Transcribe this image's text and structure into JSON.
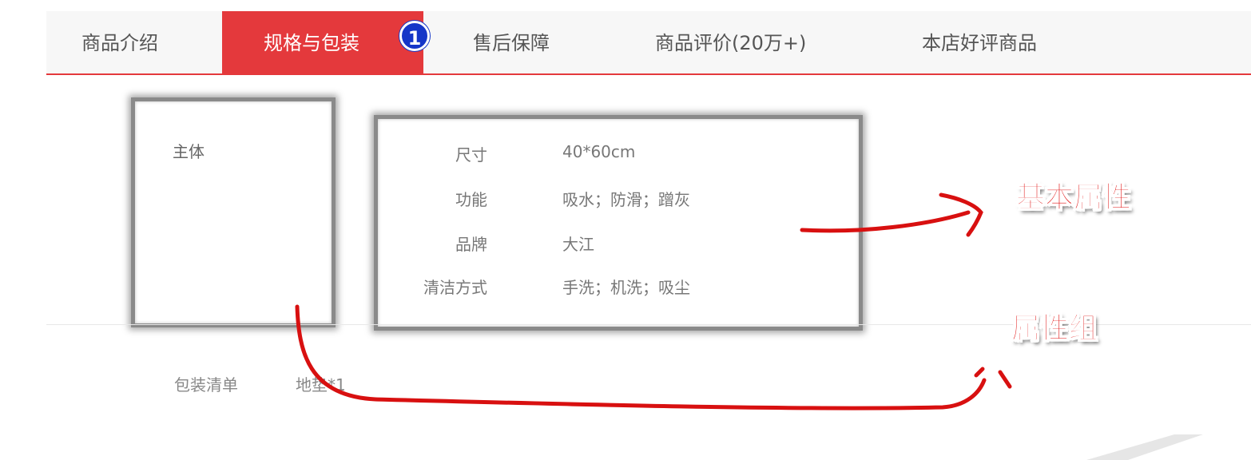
{
  "tabs": [
    {
      "label": "商品介绍"
    },
    {
      "label": "规格与包装"
    },
    {
      "label": "售后保障"
    },
    {
      "label": "商品评价(20万+)"
    },
    {
      "label": "本店好评商品"
    }
  ],
  "step_badge": "1",
  "spec": {
    "group_label": "主体",
    "attributes": [
      {
        "key": "尺寸",
        "value": "40*60cm"
      },
      {
        "key": "功能",
        "value": "吸水；防滑；蹭灰"
      },
      {
        "key": "品牌",
        "value": "大江"
      },
      {
        "key": "清洁方式",
        "value": "手洗；机洗；吸尘"
      }
    ]
  },
  "packing": {
    "label": "包装清单",
    "value": "地垫*1"
  },
  "annotations": {
    "basic_attributes": "基本属性",
    "attribute_group": "属性组"
  },
  "colors": {
    "accent": "#e4393c",
    "annotation": "#e01010",
    "badge": "#1536c8"
  }
}
